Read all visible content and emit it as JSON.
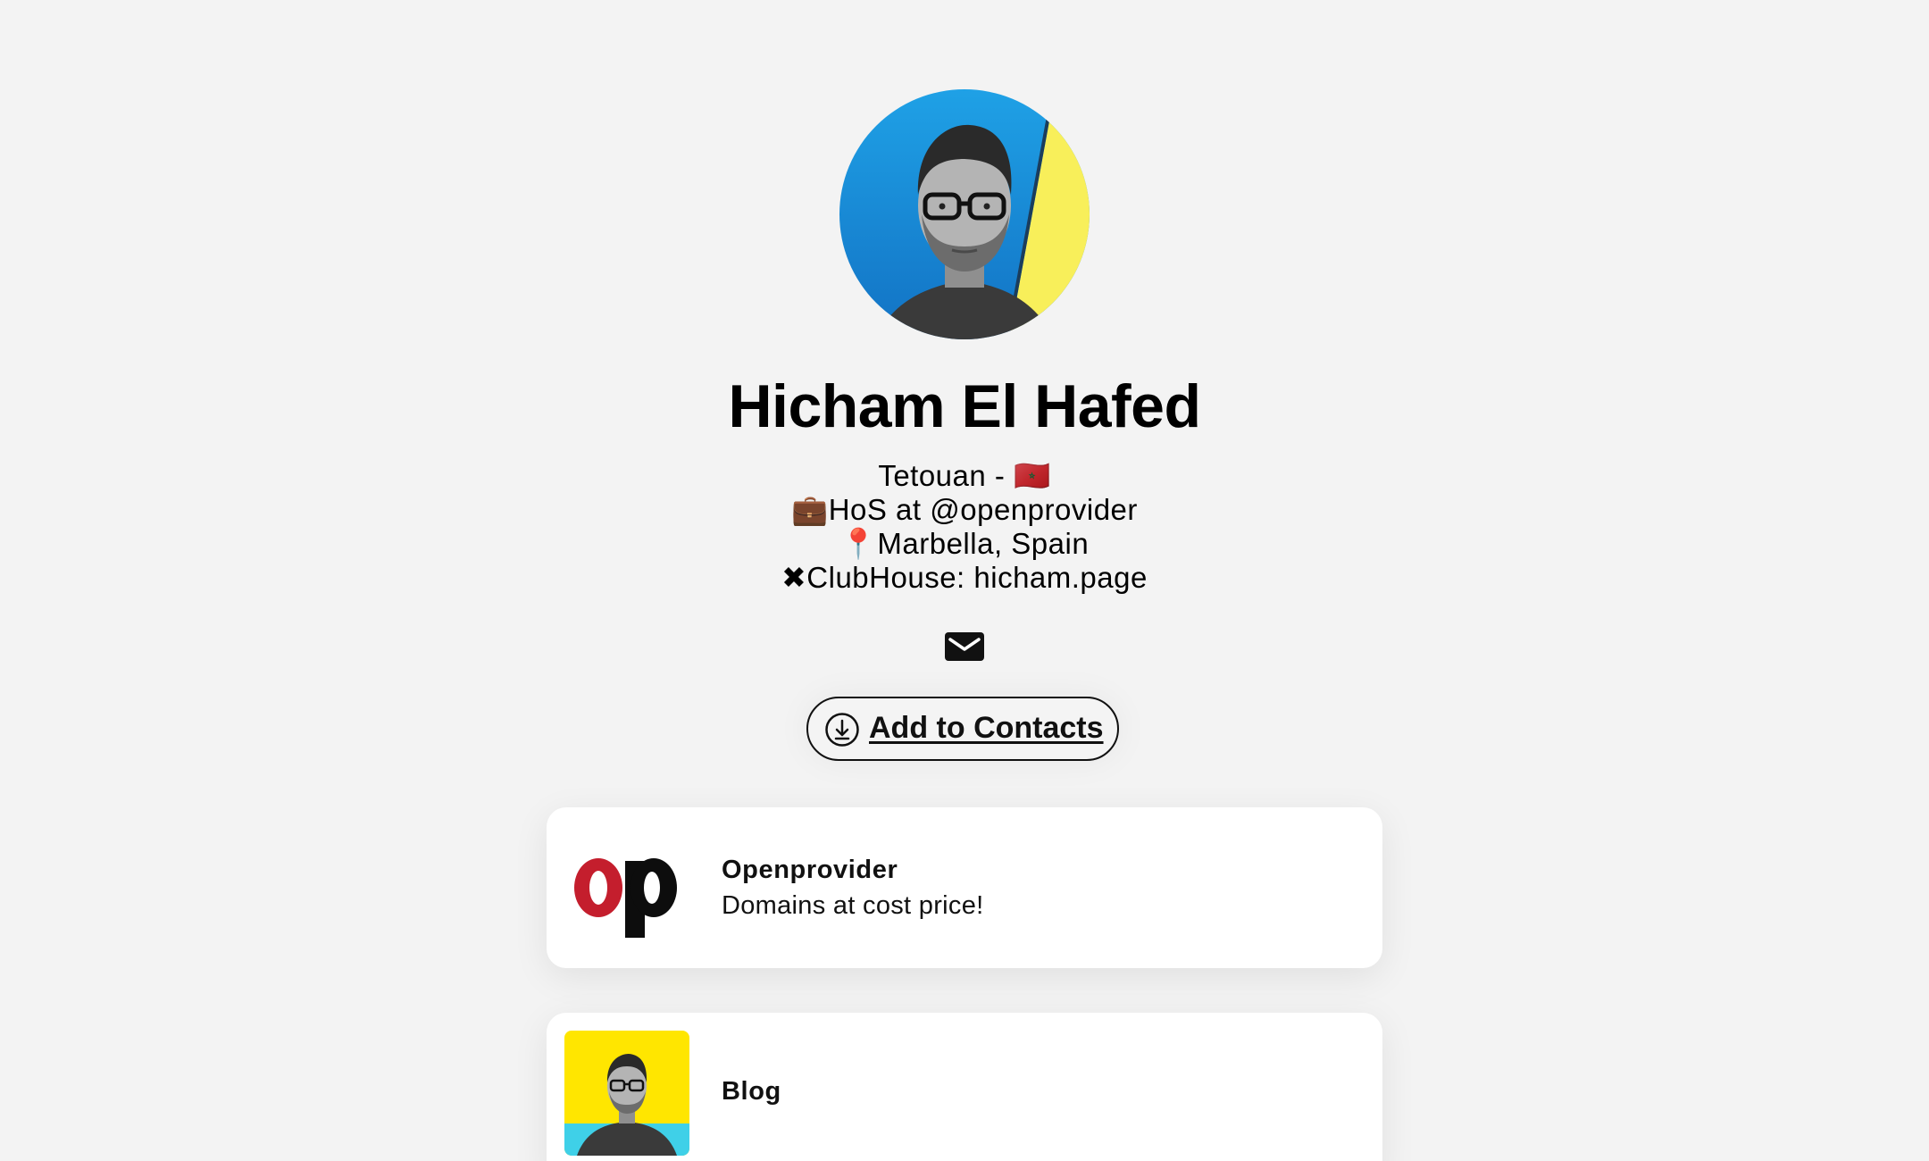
{
  "profile": {
    "name": "Hicham El Hafed",
    "bio_lines": [
      "Tetouan - 🇲🇦",
      "💼HoS at @openprovider",
      "📍Marbella, Spain",
      "✖ClubHouse: hicham.page"
    ]
  },
  "actions": {
    "email_icon": "mail-icon",
    "add_contacts_label": "Add to Contacts",
    "add_contacts_icon": "download-icon"
  },
  "links": [
    {
      "title": "Openprovider",
      "subtitle": "Domains at cost price!",
      "thumb_text": "op"
    },
    {
      "title": "Blog",
      "subtitle": ""
    }
  ],
  "colors": {
    "background": "#f3f3f3",
    "card": "#ffffff",
    "op_red": "#c41e2d",
    "avatar_blue": "#1e8fd8",
    "avatar_yellow": "#f8ef5a",
    "blog_yellow": "#ffe600"
  }
}
